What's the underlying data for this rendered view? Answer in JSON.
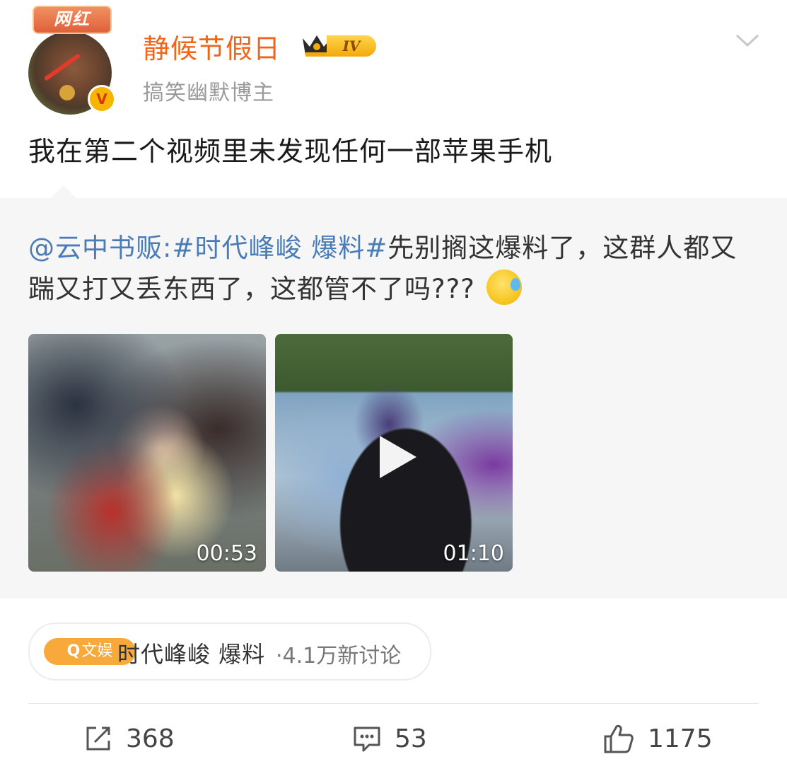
{
  "post": {
    "username": "静候节假日",
    "level": "IV",
    "avatar_badge": "网红",
    "subtitle": "搞笑幽默博主",
    "text": "我在第二个视频里未发现任何一部苹果手机"
  },
  "repost": {
    "mention": "@云中书贩:",
    "hashtag": "#时代峰峻 爆料#",
    "text": "先别搁这爆料了，这群人都又踹又打又丢东西了，这都管不了吗???",
    "emoji": "sweat-emoji",
    "videos": [
      {
        "duration": "00:53"
      },
      {
        "duration": "01:10"
      }
    ]
  },
  "topic": {
    "tag": "文娱",
    "title": "时代峰峻 爆料",
    "count": "·4.1万新讨论"
  },
  "actions": {
    "repost_count": "368",
    "comment_count": "53",
    "like_count": "1175"
  },
  "colors": {
    "username": "#f0651a",
    "link": "#4a7cb8",
    "topic_tag": "#f7a93b"
  }
}
